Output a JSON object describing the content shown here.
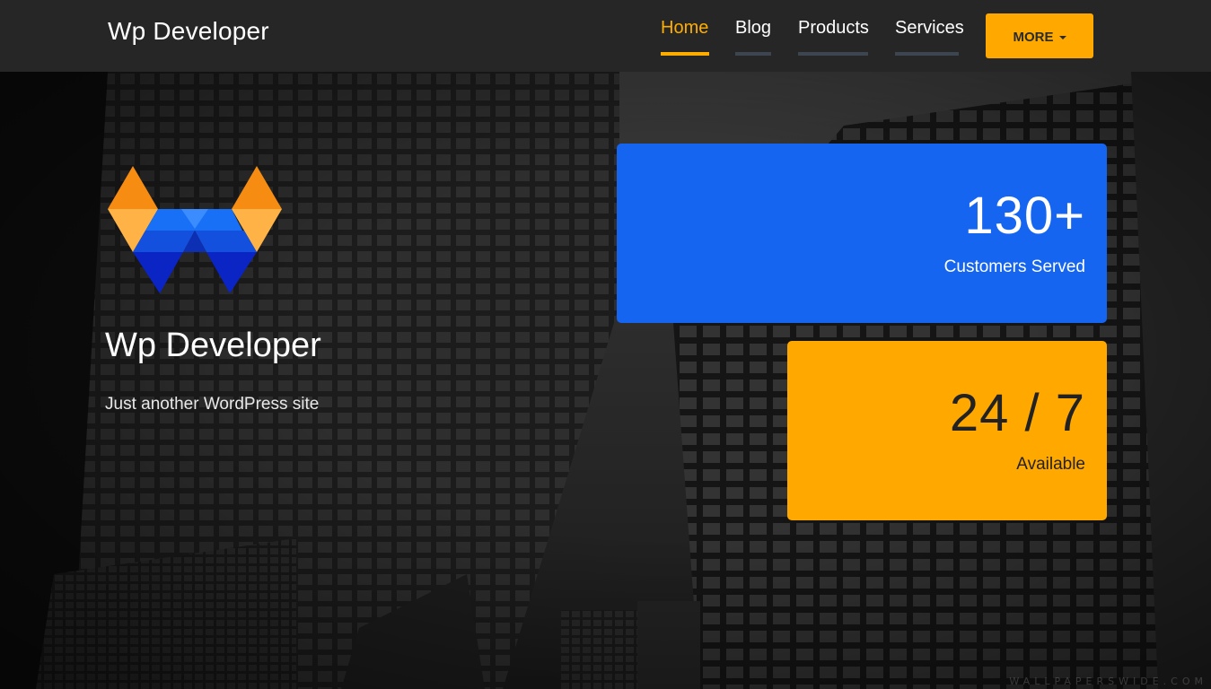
{
  "navbar": {
    "brand": "Wp Developer",
    "links": [
      {
        "label": "Home",
        "active": true
      },
      {
        "label": "Blog",
        "active": false
      },
      {
        "label": "Products",
        "active": false
      },
      {
        "label": "Services",
        "active": false
      }
    ],
    "more_label": "MORE",
    "accent": "#ffae00",
    "background": "#262626"
  },
  "hero": {
    "logo_icon": "wp-developer-w-logo",
    "site_title": "Wp Developer",
    "tagline": "Just another WordPress site"
  },
  "stats": [
    {
      "value": "130+",
      "label": "Customers Served",
      "color": "#1565f0"
    },
    {
      "value": "24 / 7",
      "label": "Available",
      "color": "#ffa800"
    }
  ],
  "watermark": "WALLPAPERSWIDE.COM"
}
